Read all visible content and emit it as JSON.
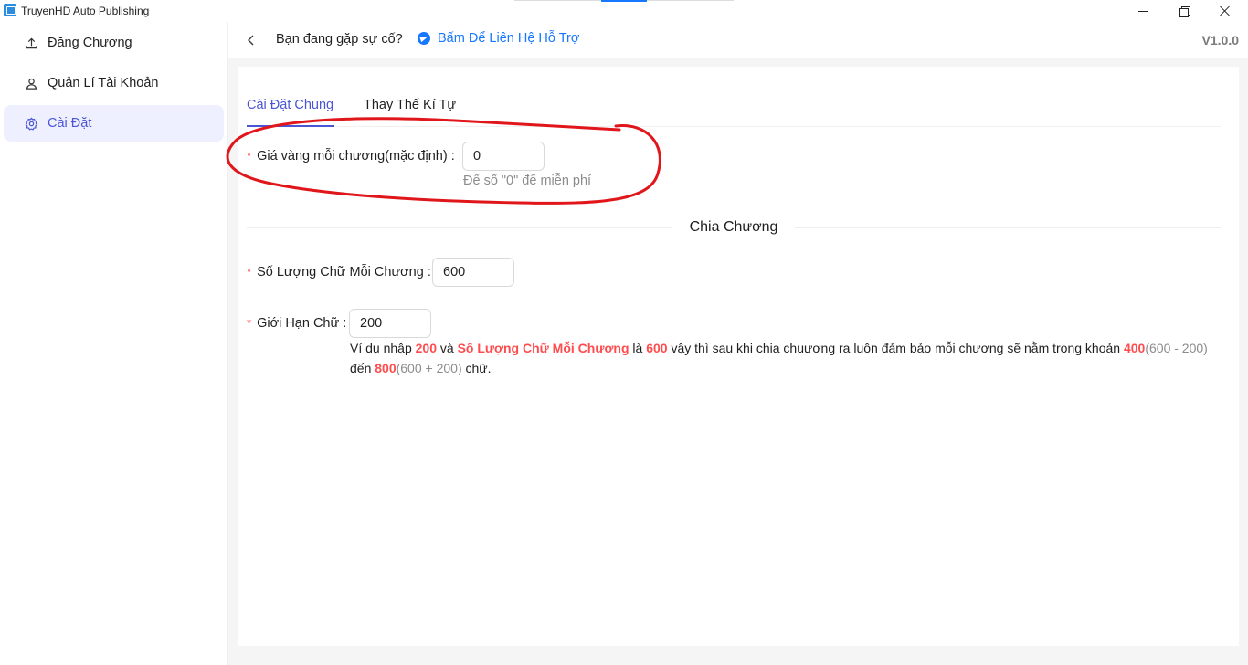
{
  "window": {
    "title": "TruyenHD Auto Publishing"
  },
  "sidebar": {
    "items": [
      {
        "label": "Đăng Chương",
        "icon": "upload-icon",
        "active": false
      },
      {
        "label": "Quản Lí Tài Khoản",
        "icon": "user-icon",
        "active": false
      },
      {
        "label": "Cài Đặt",
        "icon": "gear-icon",
        "active": true
      }
    ]
  },
  "header": {
    "issue_text": "Bạn đang gặp sự cố?",
    "support_link": "Bấm Để Liên Hệ Hỗ Trợ",
    "version": "V1.0.0"
  },
  "tabs": [
    {
      "label": "Cài Đặt Chung",
      "active": true
    },
    {
      "label": "Thay Thế Kí Tự",
      "active": false
    }
  ],
  "general": {
    "price_label": "Giá vàng mỗi chương(mặc định)",
    "price_value": "0",
    "price_hint": "Để số \"0\" để miễn phí"
  },
  "split": {
    "section_title": "Chia Chương",
    "words_label": "Số Lượng Chữ Mỗi Chương",
    "words_value": "600",
    "limit_label": "Giới Hạn Chữ",
    "limit_value": "200",
    "explain": {
      "p1": "Ví dụ nhập ",
      "v1": "200",
      "p2": " và ",
      "v2": "Số Lượng Chữ Mỗi Chương",
      "p3": " là ",
      "v3": "600",
      "p4": " vậy thì sau khi chia chuương ra luôn đảm bảo mỗi chương sẽ nằm trong khoản ",
      "v4": "400",
      "g1": "(600 - 200)",
      "p5": " đến ",
      "v5": "800",
      "g2": "(600 + 200)",
      "p6": " chữ."
    }
  },
  "colors": {
    "accent": "#4a55d6",
    "link": "#1677ff",
    "required": "#ff4d4f",
    "annotation": "#e0161b"
  }
}
